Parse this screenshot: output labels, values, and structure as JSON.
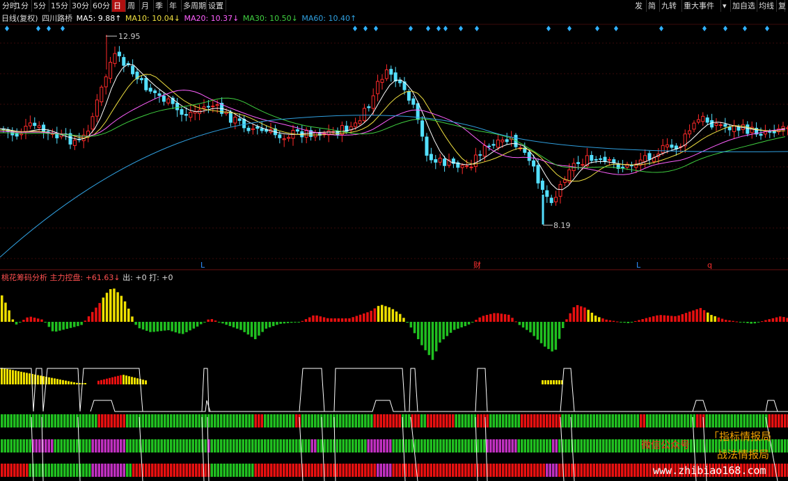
{
  "toolbar": {
    "left_items": [
      "分时",
      "1分",
      "5分",
      "15分",
      "30分",
      "60分",
      "日",
      "周",
      "月",
      "季",
      "年",
      "多周期",
      "设置"
    ],
    "active": "日",
    "right_items": [
      "发",
      "简",
      "九转",
      "重大事件",
      "▾",
      "加自选",
      "均线",
      "复"
    ]
  },
  "legend": {
    "period": "日线(复权)",
    "stock": "四川路桥",
    "ma5": "MA5: 9.88↑",
    "ma10": "MA10: 10.04↓",
    "ma20": "MA20: 10.37↓",
    "ma30": "MA30: 10.50↓",
    "ma60": "MA60: 10.40↑"
  },
  "colors": {
    "up": "#ff2a2a",
    "down": "#54e0ff",
    "ma5": "#ffffff",
    "ma10": "#f0e040",
    "ma20": "#ff60ff",
    "ma30": "#40d040",
    "ma60": "#30a0e0",
    "yellow": "#f0e000",
    "green": "#20c020",
    "magenta": "#c030c0"
  },
  "price_labels": {
    "high": "12.95",
    "low": "8.19"
  },
  "markers": [
    "L",
    "财",
    "L",
    "q"
  ],
  "indicator": {
    "name": "桃花筹码分析",
    "label": "主力控盘:",
    "value": "+61.63↓",
    "out": "出: +0",
    "hit": "打: +0"
  },
  "watermarks": {
    "w1": "微信公众号",
    "w2": "「指标情报局",
    "w3": "战法情报局",
    "w4": "www.zhibiao168.com"
  }
}
